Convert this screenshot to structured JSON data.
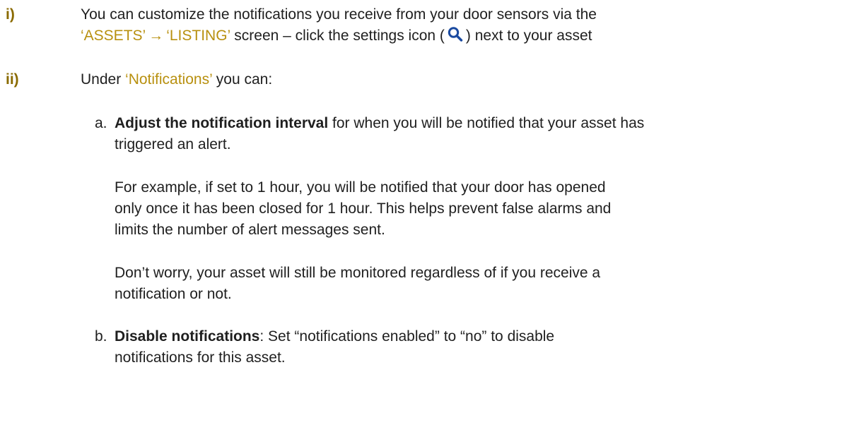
{
  "item_i": {
    "marker": "i)",
    "line1": "You can customize the notifications you receive from your door sensors via the",
    "assets": "‘ASSETS’",
    "arrow": "→",
    "listing": "‘LISTING’",
    "line2_a": " screen – click the settings icon (",
    "line2_b": ") next to your asset",
    "icon": "search-icon"
  },
  "item_ii": {
    "marker": "ii)",
    "under": "Under ",
    "notifications": "‘Notifications’",
    "you_can": " you can:"
  },
  "item_a": {
    "marker": "a.",
    "bold": "Adjust the notification interval",
    "rest1": " for when you will be notified that your asset has",
    "line2": "triggered an alert.",
    "para2_line1": "For example, if set to 1 hour, you will be notified that your door has opened",
    "para2_line2": "only once it has been closed for 1 hour. This helps prevent false alarms and",
    "para2_line3": "limits the number of alert messages sent.",
    "para3_line1": "Don’t worry, your asset will still be monitored regardless of if you receive a",
    "para3_line2": "notification or not."
  },
  "item_b": {
    "marker": "b.",
    "bold": "Disable notifications",
    "rest1": ": Set “notifications enabled” to “no” to disable",
    "line2": "notifications for this asset."
  },
  "colors": {
    "highlight": "#b8900f",
    "text": "#1f1f1f"
  }
}
